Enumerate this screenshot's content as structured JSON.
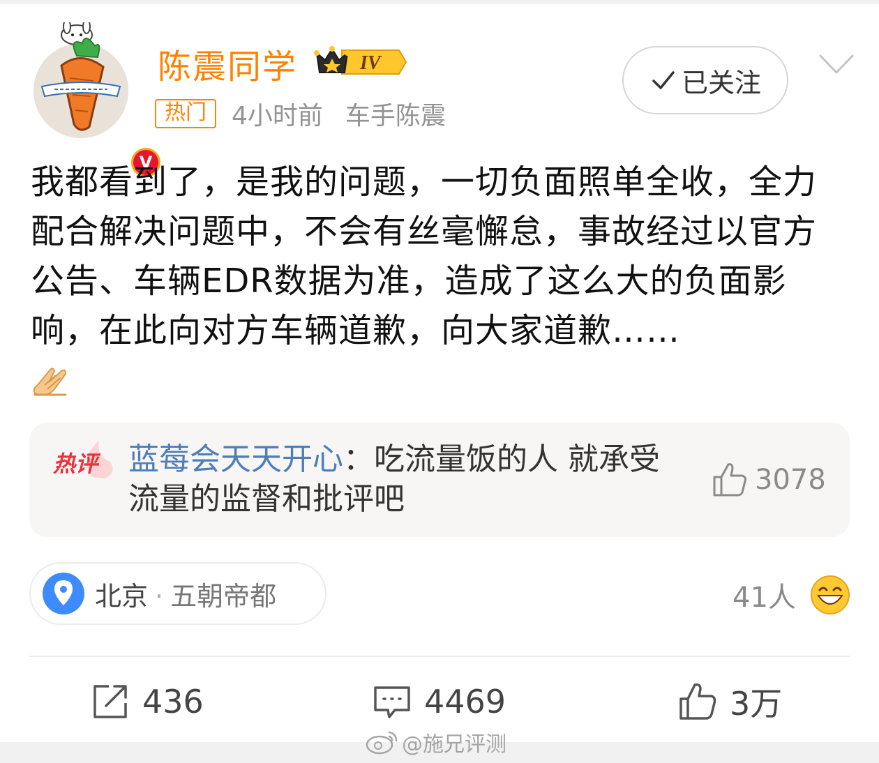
{
  "post": {
    "author": {
      "name": "陈震同学",
      "level_badge": "IV",
      "avatar_icon": "carrot-avatar-icon",
      "verified_icon": "verified-v-icon",
      "verified_letter": "V"
    },
    "meta": {
      "hot_tag": "热门",
      "time": "4小时前",
      "source": "车手陈震"
    },
    "follow_label": "已关注",
    "content": "我都看到了，是我的问题，一切负面照单全收，全力配合解决问题中，不会有丝毫懈怠，事故经过以官方公告、车辆EDR数据为准，造成了这么大的负面影响，在此向对方车辆道歉，向大家道歉……",
    "content_emoji": "folded-hands-emoji",
    "hot_comment": {
      "tag": "热评",
      "user": "蓝莓会天天开心",
      "separator": "：",
      "text": "吃流量饭的人 就承受流量的监督和批评吧",
      "likes": "3078"
    },
    "location": {
      "city": "北京",
      "separator": "·",
      "label": "五朝帝都"
    },
    "reactions": {
      "count": "41人",
      "emoji": "grinning-face-emoji"
    },
    "actions": {
      "reposts": "436",
      "comments": "4469",
      "likes": "3万"
    }
  },
  "watermark": "@施兄评测",
  "colors": {
    "username": "#ff8200",
    "link_user": "#4d7eb8",
    "hot_red": "#e8323c",
    "muted": "#939393"
  }
}
